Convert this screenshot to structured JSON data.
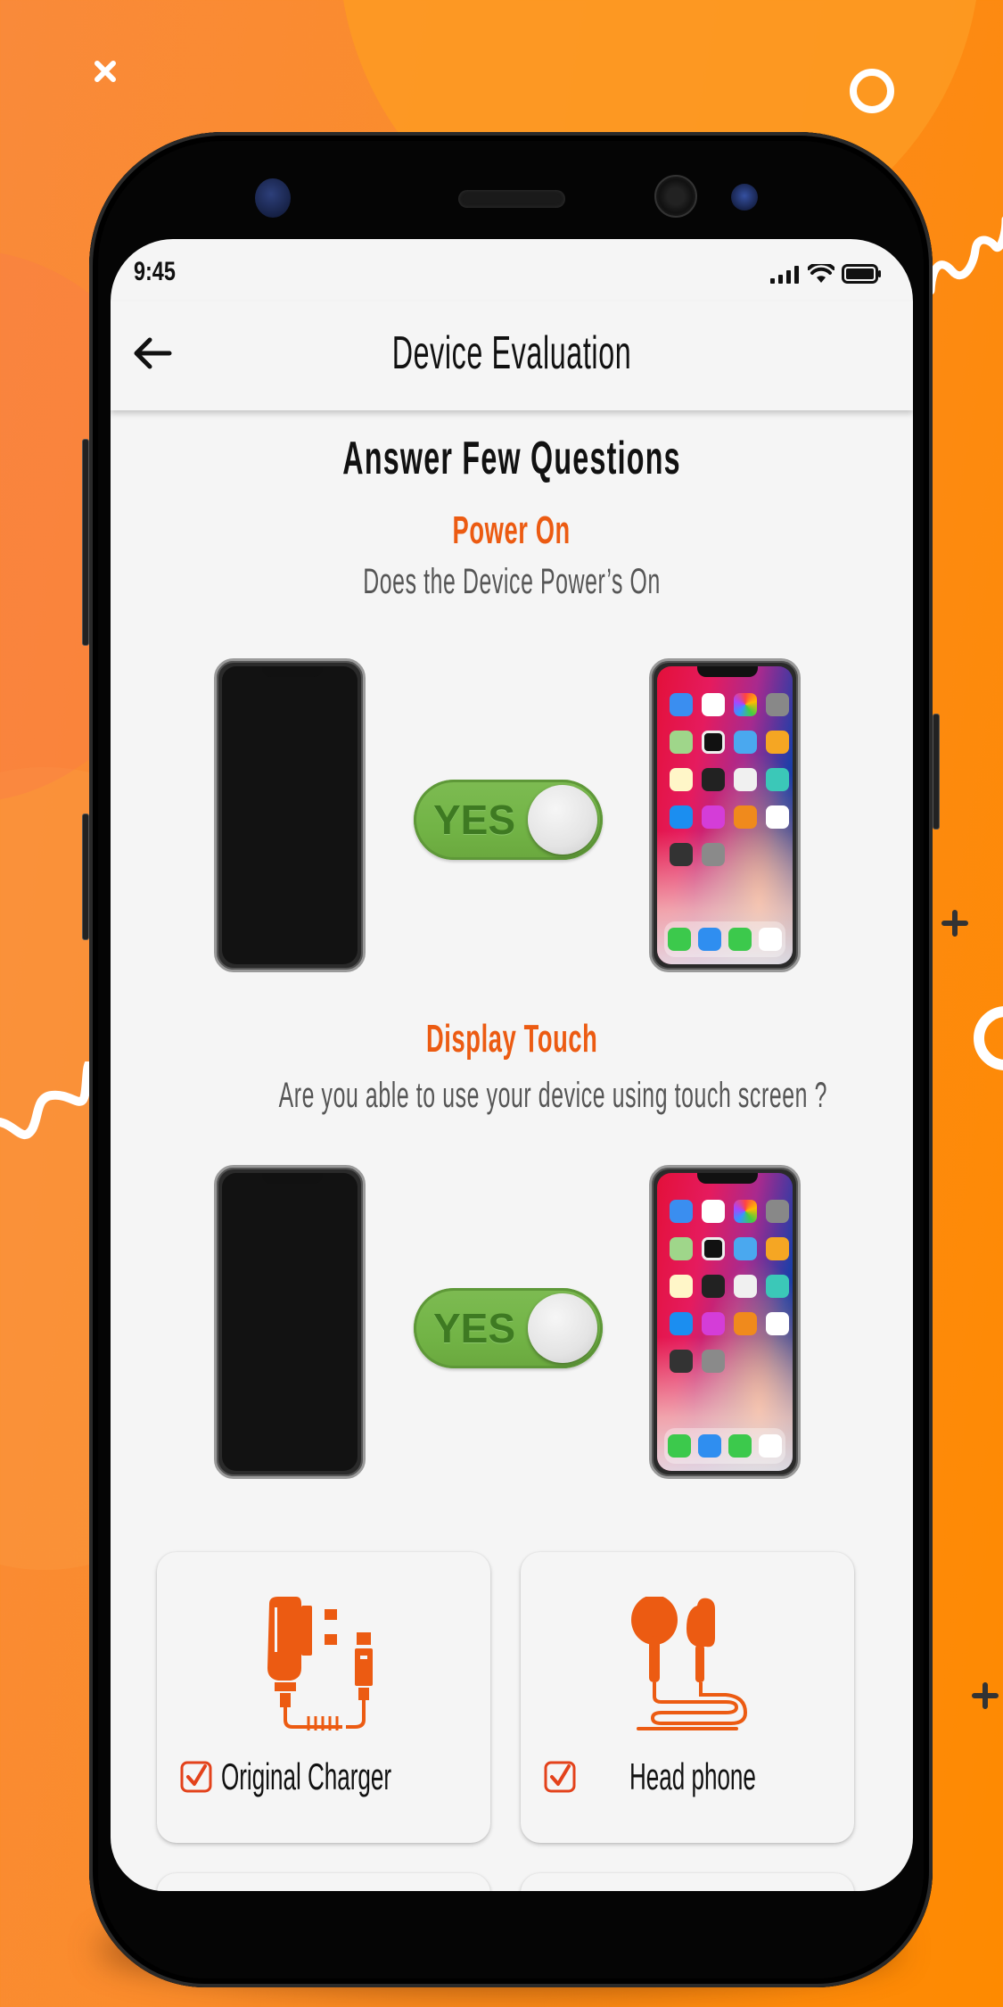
{
  "status_bar": {
    "time": "9:45",
    "icons": [
      "signal-icon",
      "wifi-icon",
      "battery-icon"
    ]
  },
  "app_bar": {
    "back_icon": "arrow-left-icon",
    "title": "Device Evaluation"
  },
  "heading": "Answer Few Questions",
  "questions": [
    {
      "title": "Power On",
      "description": "Does the Device Power’s On",
      "toggle": {
        "label": "YES",
        "on": true
      },
      "images": [
        "phone-screen-off",
        "phone-screen-on"
      ]
    },
    {
      "title": "Display Touch",
      "description": "Are you able to use your device using touch screen ?",
      "toggle": {
        "label": "YES",
        "on": true
      },
      "images": [
        "phone-screen-off",
        "phone-screen-on"
      ]
    }
  ],
  "accessories": [
    {
      "label": "Original Charger",
      "icon": "charger-icon",
      "checked": true
    },
    {
      "label": "Head phone",
      "icon": "headphone-icon",
      "checked": true
    }
  ],
  "colors": {
    "accent": "#ec5b12",
    "toggle_green": "#72b446",
    "background_orange": "#fd8a10",
    "screen_bg": "#f5f5f5"
  }
}
